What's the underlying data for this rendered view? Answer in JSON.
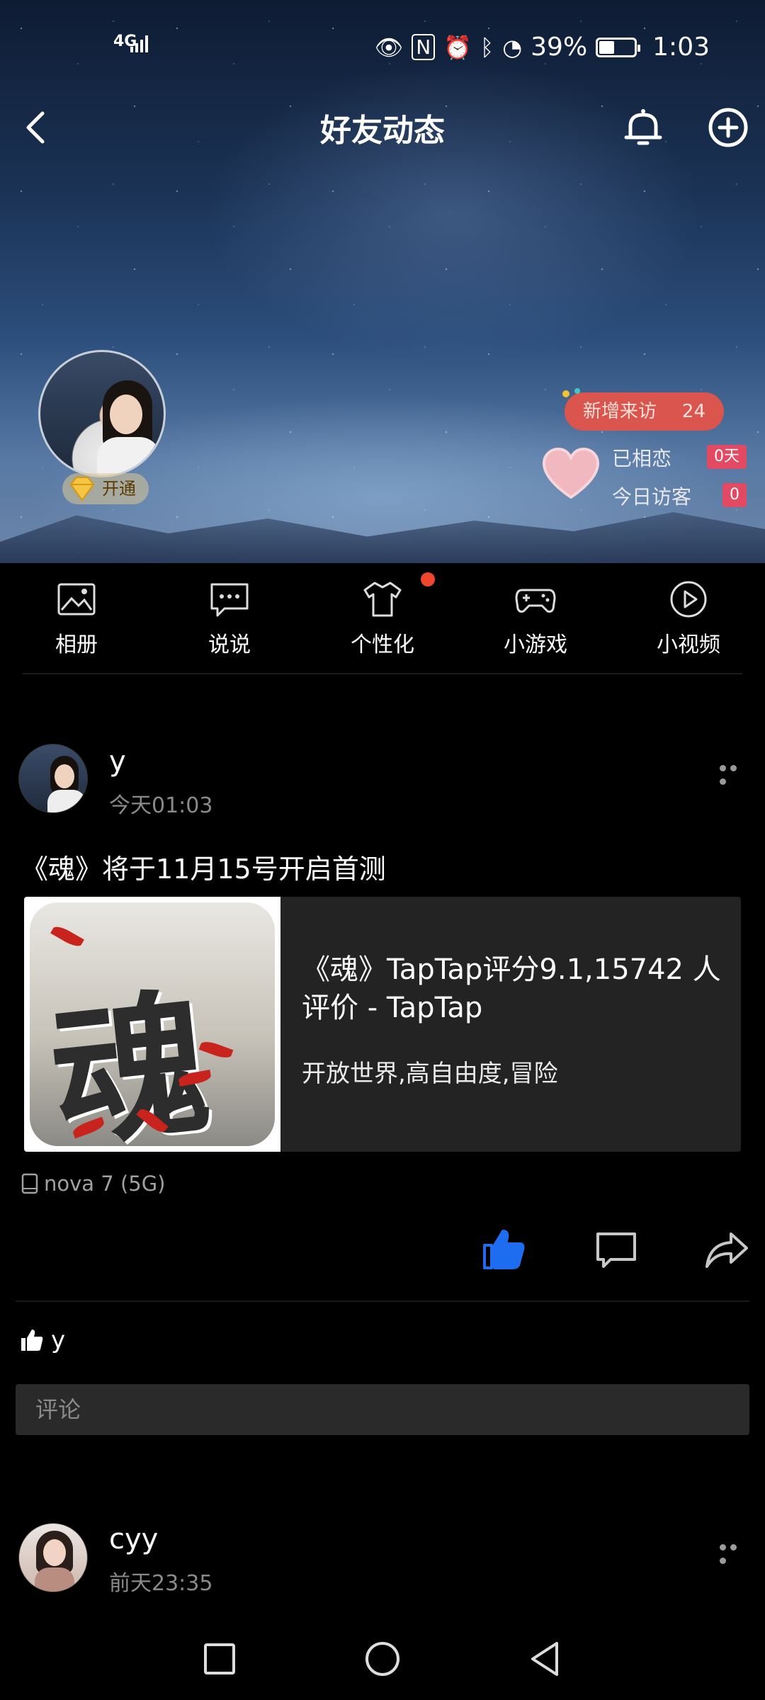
{
  "status_bar": {
    "network": "4G",
    "battery": "39%",
    "time": "1:03",
    "icons": [
      "eye-icon",
      "nfc-icon",
      "alarm-icon",
      "bluetooth-icon",
      "speed-icon",
      "battery-icon"
    ]
  },
  "header": {
    "title": "好友动态"
  },
  "profile": {
    "vip_label": "开通",
    "visit_label": "新增来访",
    "visit_count": "24",
    "love_label": "已相恋",
    "love_days": "0天",
    "today_label": "今日访客",
    "today_count": "0"
  },
  "quick_nav": {
    "items": [
      {
        "label": "相册"
      },
      {
        "label": "说说"
      },
      {
        "label": "个性化"
      },
      {
        "label": "小游戏"
      },
      {
        "label": "小视频"
      }
    ]
  },
  "feed": {
    "posts": [
      {
        "user": "y",
        "time": "今天01:03",
        "text": "《魂》将于11月15号开启首测",
        "share": {
          "thumb_char": "魂",
          "title": "《魂》TapTap评分9.1,15742 人评价 - TapTap",
          "desc": "开放世界,高自由度,冒险"
        },
        "device": "nova 7 (5G)",
        "liked_by": "y",
        "comment_placeholder": "评论"
      },
      {
        "user": "cyy",
        "time": "前天23:35"
      }
    ]
  },
  "colors": {
    "accent_blue": "#1e6cf0",
    "badge_red": "#e24a63",
    "visit_pill": "#d9554e"
  }
}
